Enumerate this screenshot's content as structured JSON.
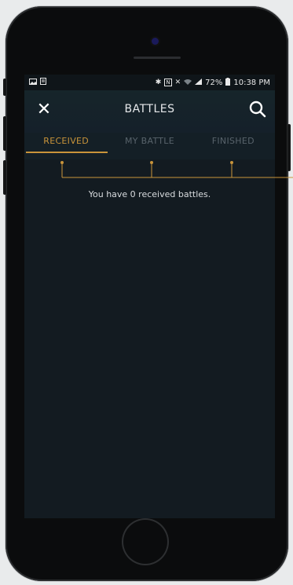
{
  "status_bar": {
    "battery": "72%",
    "time": "10:38 PM",
    "left_icons": [
      "image-icon",
      "document-icon"
    ],
    "right_icons": [
      "bluetooth-icon",
      "nfc-icon",
      "mute-icon",
      "wifi-icon",
      "signal-icon",
      "battery-icon"
    ]
  },
  "header": {
    "title": "BATTLES",
    "close_icon": "close-icon",
    "search_icon": "search-icon"
  },
  "tabs": [
    {
      "label": "RECEIVED",
      "active": true
    },
    {
      "label": "MY BATTLE",
      "active": false
    },
    {
      "label": "FINISHED",
      "active": false
    }
  ],
  "content": {
    "empty_message": "You have 0 received battles."
  },
  "colors": {
    "accent": "#c9943a",
    "background": "#131b21",
    "inactive_tab": "#58636b"
  }
}
